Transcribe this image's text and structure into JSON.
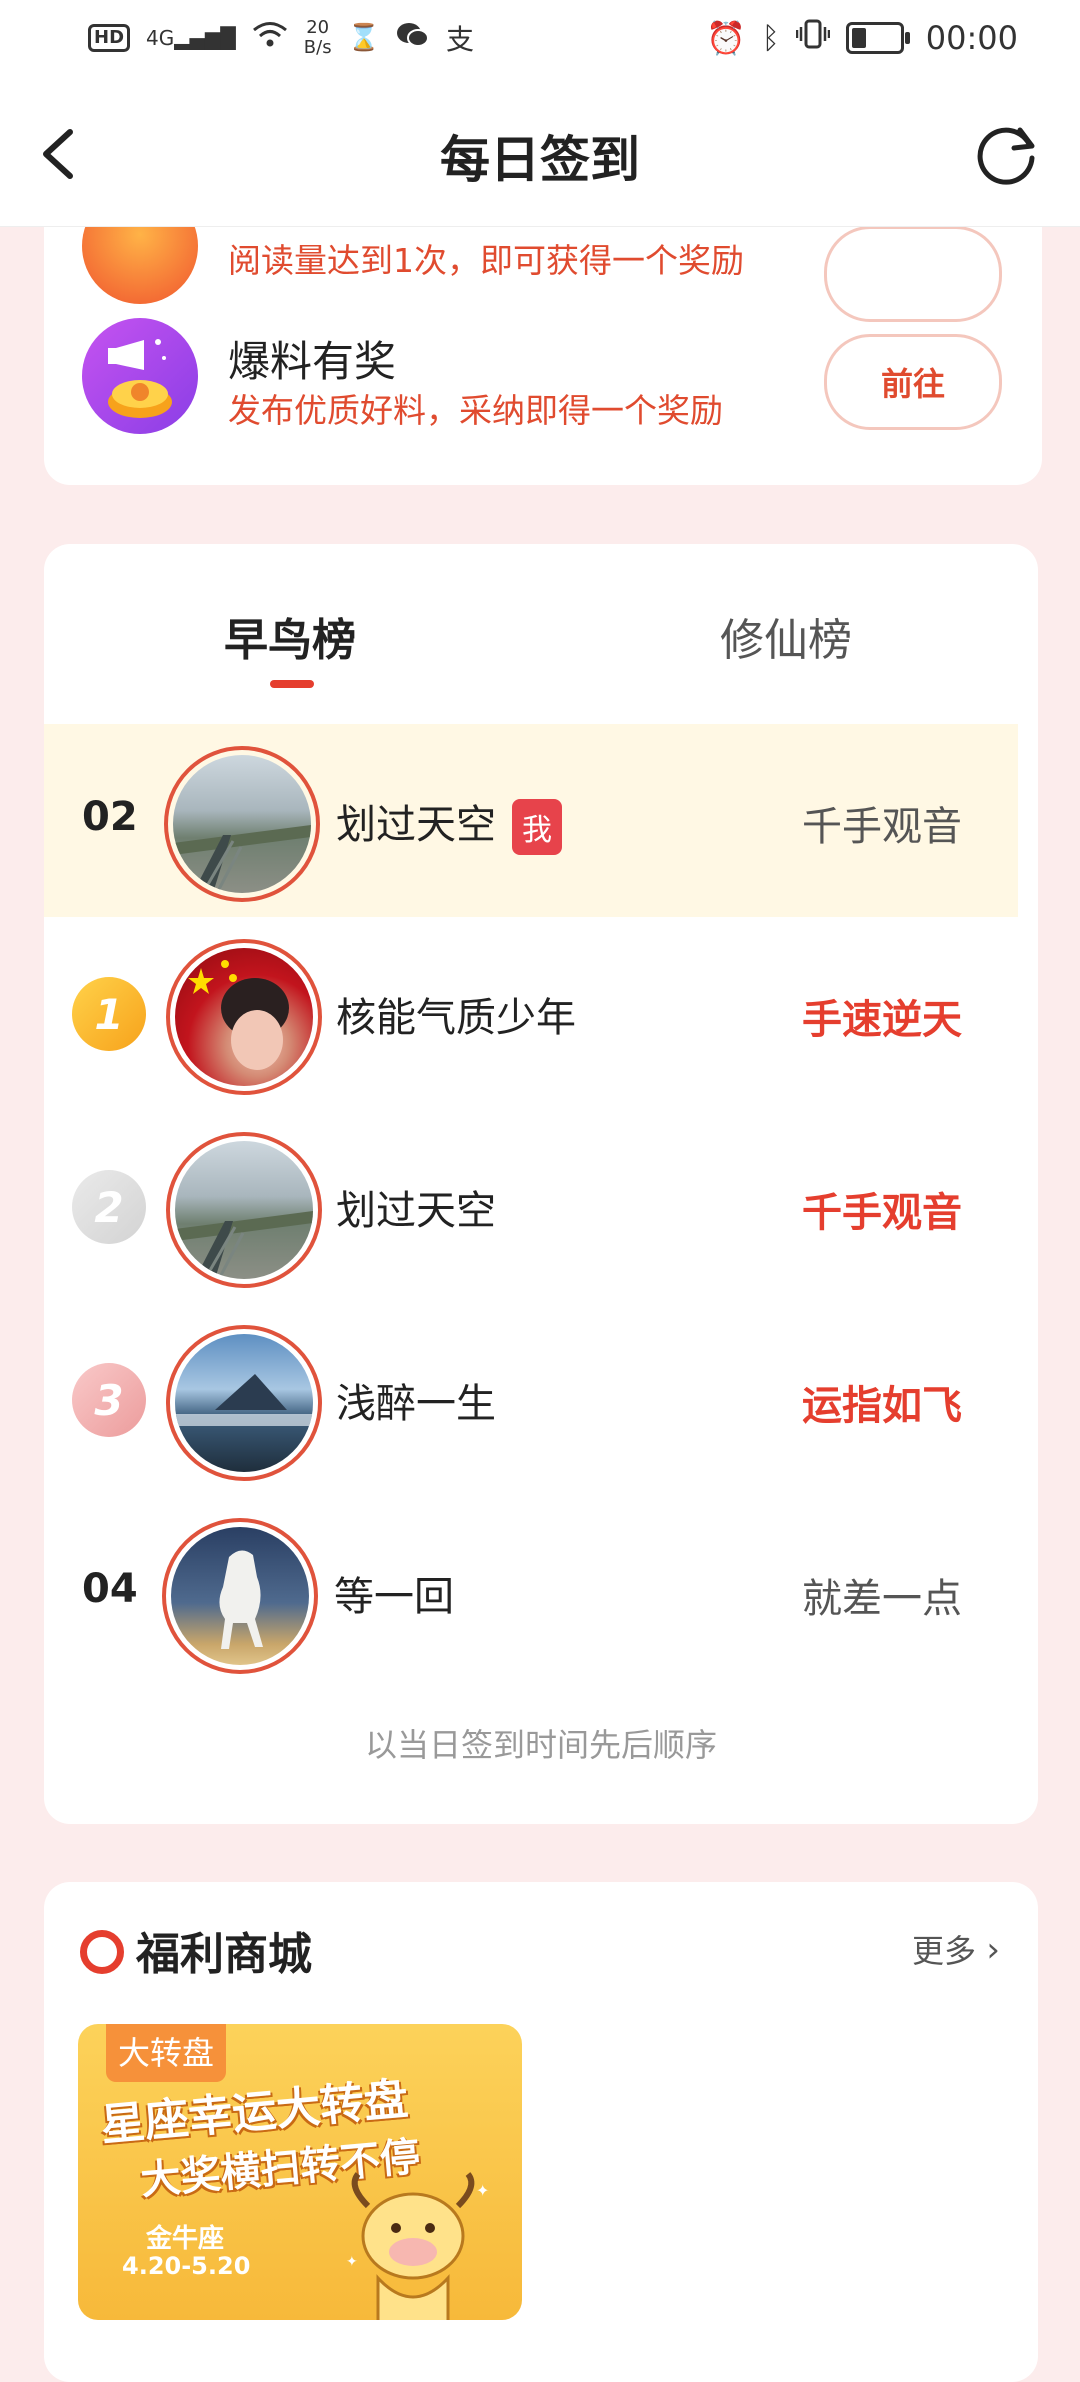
{
  "status_bar": {
    "network": "4G",
    "speed_value": "20",
    "speed_unit": "B/s",
    "hd_label": "HD",
    "time": "00:00"
  },
  "header": {
    "title": "每日签到"
  },
  "tasks": [
    {
      "title": "",
      "description": "阅读量达到1次，即可获得一个奖励",
      "button": ""
    },
    {
      "title": "爆料有奖",
      "description": "发布优质好料，采纳即得一个奖励",
      "button": "前往"
    }
  ],
  "leaderboard": {
    "tabs": [
      "早鸟榜",
      "修仙榜"
    ],
    "active_tab": 0,
    "me_row": {
      "rank": "02",
      "name": "划过天空",
      "badge": "我",
      "title": "千手观音"
    },
    "rows": [
      {
        "rank": "1",
        "name": "核能气质少年",
        "title": "手速逆天"
      },
      {
        "rank": "2",
        "name": "划过天空",
        "title": "千手观音"
      },
      {
        "rank": "3",
        "name": "浅醉一生",
        "title": "运指如飞"
      },
      {
        "rank": "04",
        "name": "等一回",
        "title": "就差一点"
      }
    ],
    "footnote": "以当日签到时间先后顺序"
  },
  "shop": {
    "title": "福利商城",
    "more": "更多",
    "promo": {
      "tag": "大转盘",
      "line1": "星座幸运大转盘",
      "line2": "大奖横扫转不停",
      "sign": "金牛座",
      "date": "4.20-5.20"
    }
  },
  "colors": {
    "accent": "#e53e2e",
    "background": "#fcecec",
    "me_row": "#fff8e4"
  }
}
